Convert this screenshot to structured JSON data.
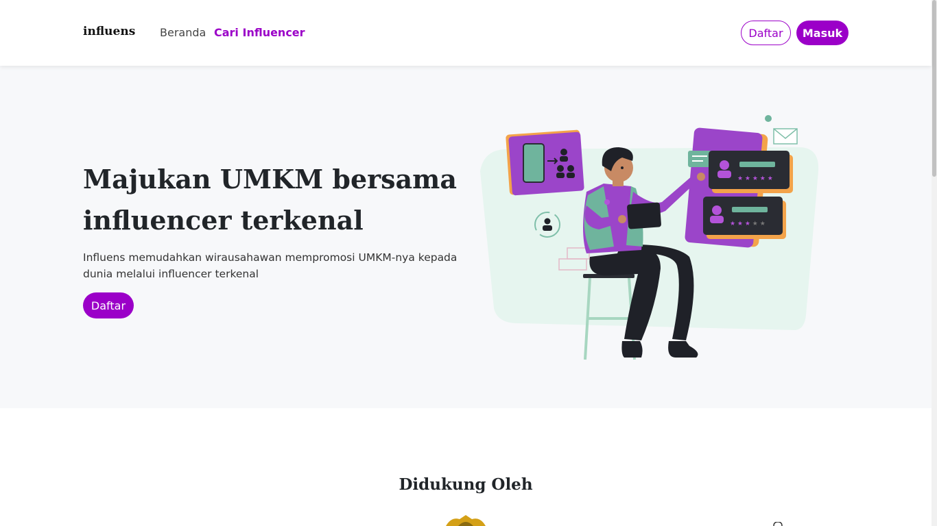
{
  "navbar": {
    "brand": "influens",
    "links": [
      {
        "label": "Beranda"
      },
      {
        "label": "Cari Influencer"
      }
    ],
    "register_label": "Daftar",
    "login_label": "Masuk"
  },
  "hero": {
    "title": "Majukan UMKM bersama influencer terkenal",
    "description": "Influens memudahkan wirausahawan mempromosi UMKM-nya kepada dunia melalui influencer terkenal",
    "cta_label": "Daftar",
    "illustration_icon": "influencer-marketing-illustration"
  },
  "supported": {
    "title": "Didukung Oleh"
  },
  "colors": {
    "accent": "#9b00c8",
    "hero_bg": "#f7f8fa"
  }
}
